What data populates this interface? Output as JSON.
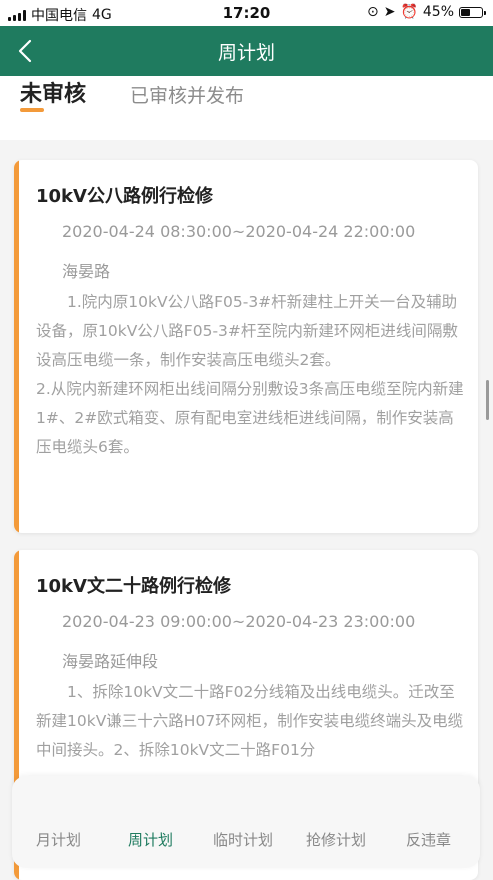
{
  "status_bar": {
    "carrier": "中国电信",
    "network": "4G",
    "time": "17:20",
    "battery": "45%",
    "battery_level": 0.45
  },
  "nav": {
    "title": "周计划"
  },
  "tabs": {
    "active": "未审核",
    "inactive": "已审核并发布"
  },
  "cards": [
    {
      "title": "10kV公八路例行检修",
      "time": "2020-04-24 08:30:00~2020-04-24 22:00:00",
      "location": "海晏路",
      "desc1": "1.院内原10kV公八路F05-3#杆新建柱上开关一台及辅助设备，原10kV公八路F05-3#杆至院内新建环网柜进线间隔敷设高压电缆一条，制作安装高压电缆头2套。",
      "desc2": "2.从院内新建环网柜出线间隔分别敷设3条高压电缆至院内新建1#、2#欧式箱变、原有配电室进线柜进线间隔，制作安装高压电缆头6套。"
    },
    {
      "title": "10kV文二十路例行检修",
      "time": "2020-04-23 09:00:00~2020-04-23 23:00:00",
      "location": "海晏路延伸段",
      "desc1": "1、拆除10kV文二十路F02分线箱及出线电缆头。迁改至新建10kV谦三十六路H07环网柜，制作安装电缆终端头及电缆中间接头。2、拆除10kV文二十路F01分"
    }
  ],
  "bottom_nav": {
    "items": [
      "月计划",
      "周计划",
      "临时计划",
      "抢修计划",
      "反违章"
    ],
    "active": "周计划"
  },
  "colors": {
    "primary": "#1f7b5f",
    "accent": "#f39a3a"
  }
}
